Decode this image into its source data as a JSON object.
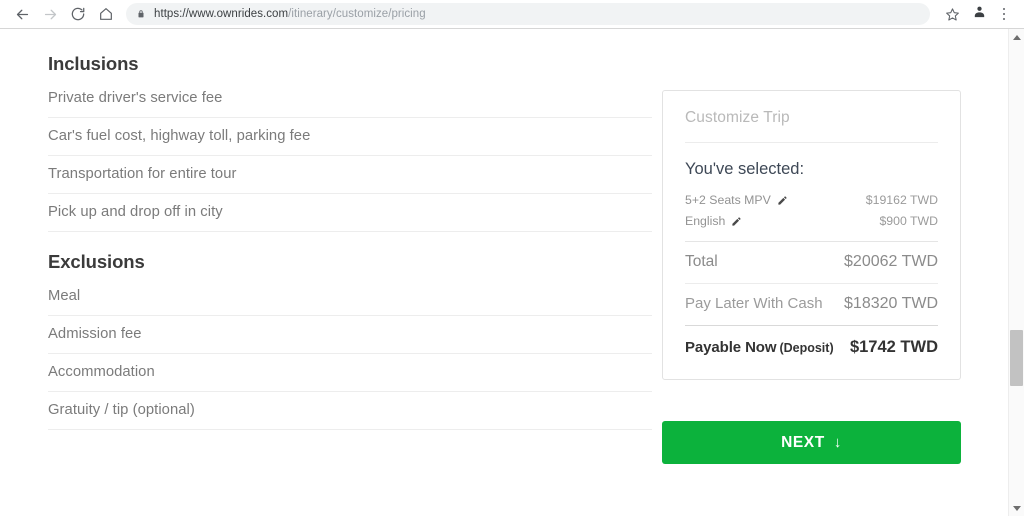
{
  "browser": {
    "back_icon": "back-arrow-icon",
    "forward_icon": "forward-arrow-icon",
    "reload_icon": "reload-icon",
    "home_icon": "home-icon",
    "lock_icon": "lock-icon",
    "url_domain": "https://www.ownrides.com",
    "url_path": "/itinerary/customize/pricing",
    "bookmark_icon": "star-icon",
    "profile_icon": "profile-avatar-icon",
    "menu_icon": "three-dot-menu-icon"
  },
  "main": {
    "inclusions": {
      "title": "Inclusions",
      "items": [
        "Private driver's service fee",
        "Car's fuel cost, highway toll, parking fee",
        "Transportation for entire tour",
        "Pick up and drop off in city"
      ]
    },
    "exclusions": {
      "title": "Exclusions",
      "items": [
        "Meal",
        "Admission fee",
        "Accommodation",
        "Gratuity / tip (optional)"
      ]
    }
  },
  "summary": {
    "card_title": "Customize Trip",
    "selected_heading": "You've selected:",
    "selections": [
      {
        "label": "5+2 Seats MPV",
        "edit_icon": "pencil-icon",
        "price": "$19162 TWD"
      },
      {
        "label": "English",
        "edit_icon": "pencil-icon",
        "price": "$900 TWD"
      }
    ],
    "total_label": "Total",
    "total_value": "$20062 TWD",
    "pay_later_label": "Pay Later With Cash",
    "pay_later_value": "$18320 TWD",
    "payable_label": "Payable Now",
    "payable_sub_label": "(Deposit)",
    "payable_value": "$1742 TWD"
  },
  "next_button": {
    "label": "NEXT",
    "arrow": "↓",
    "color": "#0cb23c"
  },
  "scrollbar": {
    "up_icon": "scroll-up-arrow-icon",
    "down_icon": "scroll-down-arrow-icon",
    "thumb": "scrollbar-thumb"
  }
}
